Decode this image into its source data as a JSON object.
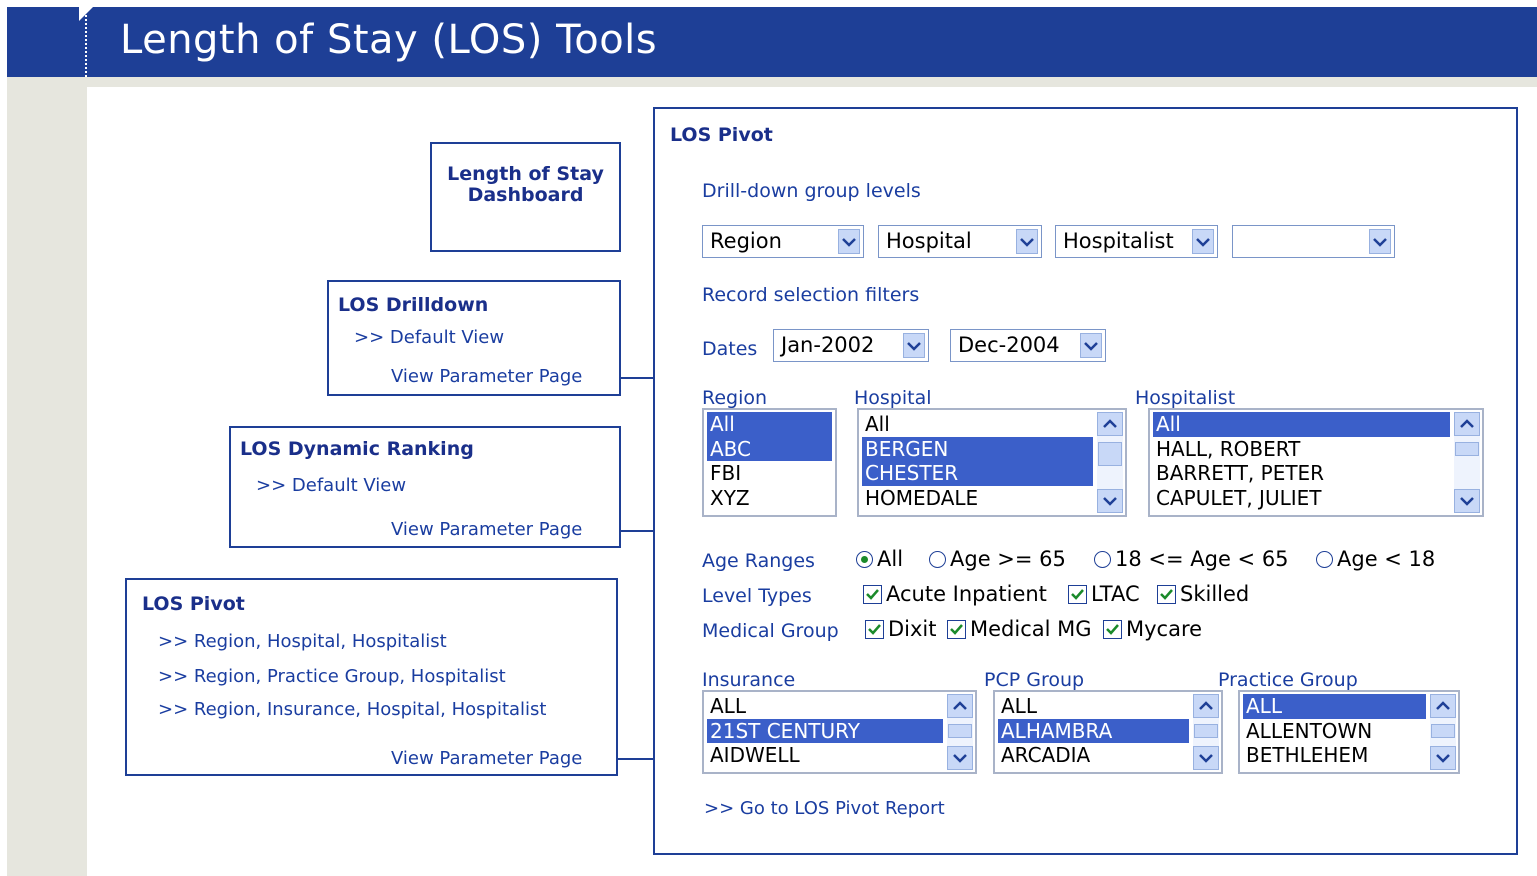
{
  "header": {
    "title": "Length of Stay (LOS) Tools"
  },
  "nav": {
    "dashboard": {
      "title": "Length of Stay Dashboard",
      "title_line1": "Length of Stay",
      "title_line2": "Dashboard"
    },
    "drilldown": {
      "title": "LOS Drilldown",
      "links": [
        ">> Default View"
      ],
      "param_link": "View Parameter Page"
    },
    "ranking": {
      "title": "LOS Dynamic Ranking",
      "links": [
        ">> Default View"
      ],
      "param_link": "View Parameter Page"
    },
    "pivot": {
      "title": "LOS Pivot",
      "links": [
        ">> Region, Hospital, Hospitalist",
        ">> Region, Practice Group, Hospitalist",
        ">> Region, Insurance, Hospital, Hospitalist"
      ],
      "param_link": "View Parameter Page"
    }
  },
  "panel": {
    "title": "LOS Pivot",
    "drill_label": "Drill-down group levels",
    "drill_levels": [
      "Region",
      "Hospital",
      "Hospitalist",
      ""
    ],
    "filters_label": "Record selection filters",
    "dates_label": "Dates",
    "date_from": "Jan-2002",
    "date_to": "Dec-2004",
    "region": {
      "label": "Region",
      "items": [
        "All",
        "ABC",
        "FBI",
        "XYZ"
      ],
      "selected": [
        0,
        1
      ]
    },
    "hospital": {
      "label": "Hospital",
      "items": [
        "All",
        "BERGEN",
        "CHESTER",
        "HOMEDALE"
      ],
      "selected": [
        1,
        2
      ]
    },
    "hospitalist": {
      "label": "Hospitalist",
      "items": [
        "All",
        "HALL, ROBERT",
        "BARRETT, PETER",
        "CAPULET, JULIET"
      ],
      "selected": [
        0
      ]
    },
    "age_label": "Age Ranges",
    "age_options": [
      "All",
      "Age >= 65",
      "18 <= Age < 65",
      "Age < 18"
    ],
    "age_selected": 0,
    "level_label": "Level Types",
    "level_options": [
      "Acute Inpatient",
      "LTAC",
      "Skilled"
    ],
    "medical_label": "Medical Group",
    "medical_options": [
      "Dixit",
      "Medical MG",
      "Mycare"
    ],
    "insurance": {
      "label": "Insurance",
      "items": [
        "ALL",
        "21ST CENTURY",
        "AIDWELL"
      ],
      "selected": [
        1
      ]
    },
    "pcp": {
      "label": "PCP Group",
      "items": [
        "ALL",
        "ALHAMBRA",
        "ARCADIA"
      ],
      "selected": [
        1
      ]
    },
    "practice": {
      "label": "Practice Group",
      "items": [
        "ALL",
        "ALLENTOWN",
        "BETHLEHEM"
      ],
      "selected": [
        0
      ]
    },
    "go_link": ">> Go to LOS Pivot Report"
  }
}
